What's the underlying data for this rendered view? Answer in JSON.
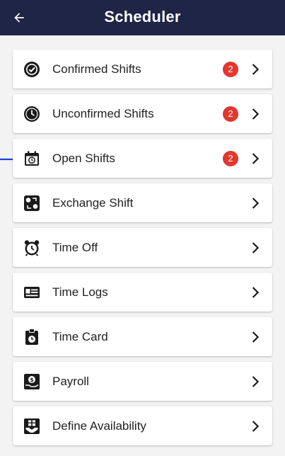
{
  "header": {
    "title": "Scheduler",
    "back_icon": "arrow-left-icon",
    "background": "#1e2545"
  },
  "menu": {
    "items": [
      {
        "label": "Confirmed Shifts",
        "icon": "check-circle-icon",
        "badge": "2"
      },
      {
        "label": "Unconfirmed Shifts",
        "icon": "clock-icon",
        "badge": "2"
      },
      {
        "label": "Open Shifts",
        "icon": "calendar-clock-icon",
        "badge": "2"
      },
      {
        "label": "Exchange Shift",
        "icon": "exchange-icon"
      },
      {
        "label": "Time Off",
        "icon": "alarm-clock-icon"
      },
      {
        "label": "Time Logs",
        "icon": "id-card-icon"
      },
      {
        "label": "Time Card",
        "icon": "time-card-icon"
      },
      {
        "label": "Payroll",
        "icon": "payroll-icon"
      },
      {
        "label": "Define Availability",
        "icon": "hand-gift-icon"
      }
    ]
  },
  "colors": {
    "badge": "#e2372d",
    "pointer_arrow": "#1f3fd6"
  }
}
